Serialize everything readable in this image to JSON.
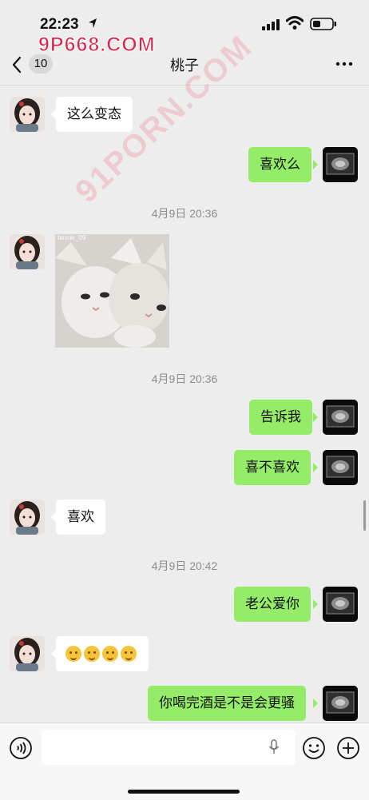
{
  "status_bar": {
    "time": "22:23"
  },
  "watermark": {
    "top": "9P668.COM",
    "diagonal": "91PORN.COM"
  },
  "header": {
    "back_badge": "10",
    "title": "桃子"
  },
  "messages": [
    {
      "side": "in",
      "text": "这么变态"
    },
    {
      "side": "out",
      "text": "喜欢么"
    },
    {
      "type": "timestamp",
      "text": "4月9日 20:36"
    },
    {
      "side": "in",
      "type": "image",
      "caption": "fannie_09"
    },
    {
      "type": "timestamp",
      "text": "4月9日 20:36"
    },
    {
      "side": "out",
      "text": "告诉我"
    },
    {
      "side": "out",
      "text": "喜不喜欢"
    },
    {
      "side": "in",
      "text": "喜欢"
    },
    {
      "type": "timestamp",
      "text": "4月9日 20:42"
    },
    {
      "side": "out",
      "text": "老公爱你"
    },
    {
      "side": "in",
      "type": "emoji",
      "count": 4,
      "emoji": "smiling-face"
    },
    {
      "side": "out",
      "text": "你喝完酒是不是会更骚"
    }
  ],
  "input": {
    "value": "",
    "placeholder": ""
  },
  "colors": {
    "background": "#ededed",
    "outgoing_bubble": "#95ec69",
    "incoming_bubble": "#ffffff",
    "watermark": "#e0214a"
  },
  "icons": [
    "location-arrow-icon",
    "signal-icon",
    "wifi-icon",
    "battery-icon",
    "back-chevron-icon",
    "more-icon",
    "voice-icon",
    "mic-icon",
    "emoji-icon",
    "plus-icon"
  ]
}
